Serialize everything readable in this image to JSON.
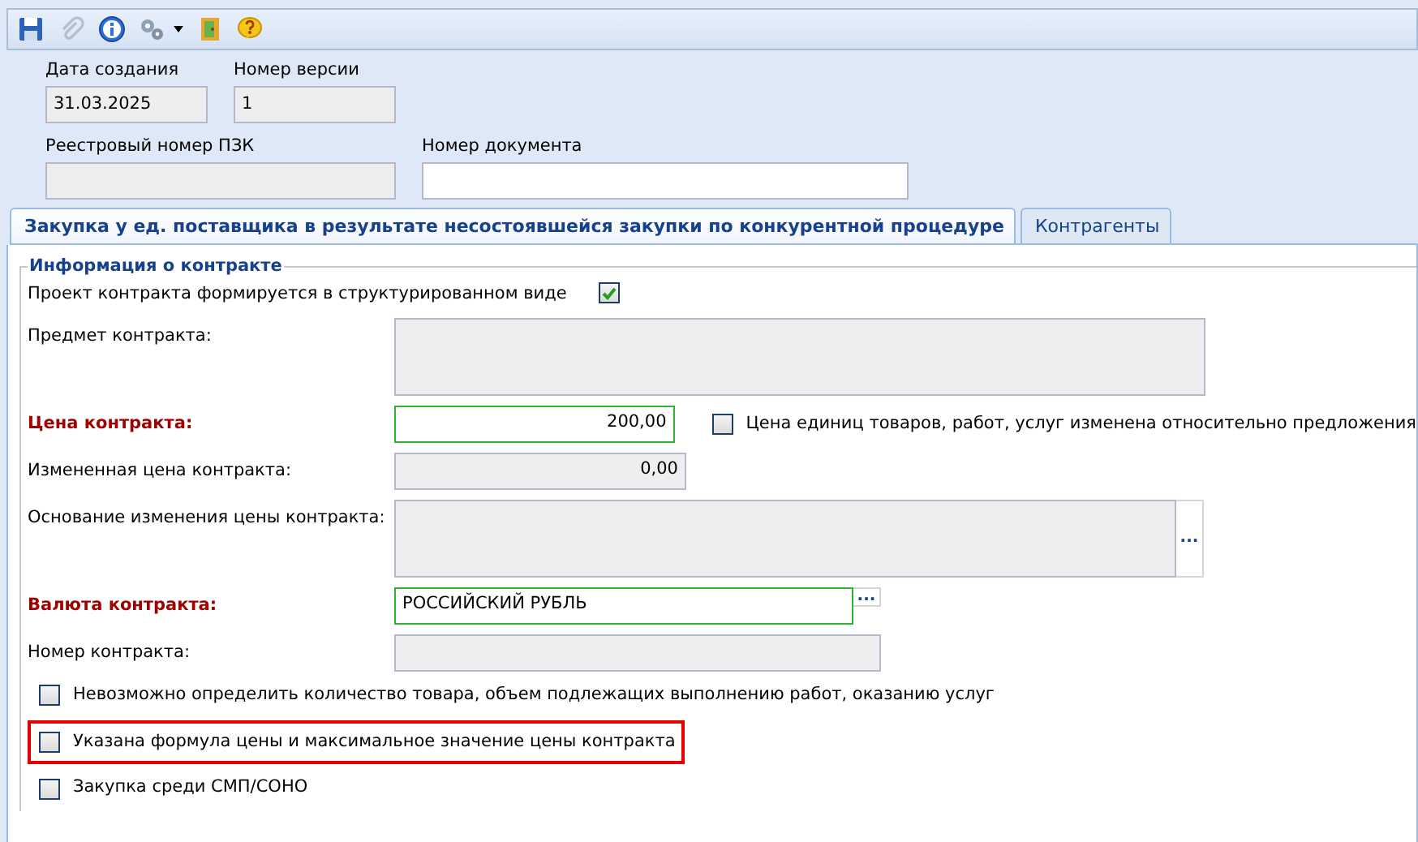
{
  "toolbar": {
    "items": [
      {
        "kind": "save"
      },
      {
        "kind": "attach",
        "disabled": true
      },
      {
        "kind": "info"
      },
      {
        "kind": "tools",
        "dropdown": true
      },
      {
        "kind": "exit"
      },
      {
        "kind": "help"
      }
    ]
  },
  "header_rows": [
    [
      {
        "label": "Дата создания",
        "value": "31.03.2025",
        "readonly": true
      },
      {
        "label": "Номер версии",
        "value": "1",
        "readonly": true
      }
    ],
    [
      {
        "label": "Реестровый номер ПЗК",
        "readonly": true
      },
      {
        "label": "Номер документа",
        "readonly": false
      }
    ]
  ],
  "tabs": [
    {
      "label": "Закупка у ед. поставщика в результате несостоявшейся закупки по конкурентной процедуре",
      "selected": true
    },
    {
      "label": "Контрагенты",
      "selected": false
    }
  ],
  "section": {
    "title": "Информация о контракте",
    "rows": [
      {
        "kind": "flag",
        "label": "Проект контракта формируется в структурированном виде",
        "checked": true
      },
      {
        "kind": "memo",
        "label": "Предмет контракта:",
        "required": false,
        "readonly": true
      },
      {
        "kind": "number",
        "label": "Цена контракта:",
        "value": "200,00",
        "required": true,
        "readonly": false,
        "side_check": {
          "label": "Цена единиц товаров, работ, услуг изменена относительно предложения",
          "checked": false
        }
      },
      {
        "kind": "number",
        "label": "Измененная цена контракта:",
        "value": "0,00",
        "required": false,
        "readonly": true
      },
      {
        "kind": "memo",
        "label": "Основание изменения цены контракта:",
        "required": false,
        "readonly": true,
        "lookup": "..."
      },
      {
        "kind": "lookup",
        "label": "Валюта контракта:",
        "value": "РОССИЙСКИЙ РУБЛЬ",
        "required": true,
        "readonly": false,
        "lookup": "..."
      },
      {
        "kind": "text",
        "label": "Номер контракта:",
        "required": false,
        "readonly": true
      },
      {
        "kind": "check",
        "label": "Невозможно определить количество товара, объем подлежащих выполнению работ, оказанию услуг",
        "checked": false,
        "highlighted": false
      },
      {
        "kind": "check",
        "label": "Указана формула цены и максимальное значение цены контракта",
        "checked": false,
        "highlighted": true
      },
      {
        "kind": "check",
        "label": "Закупка среди СМП/СОНО",
        "checked": false,
        "highlighted": false
      }
    ]
  }
}
